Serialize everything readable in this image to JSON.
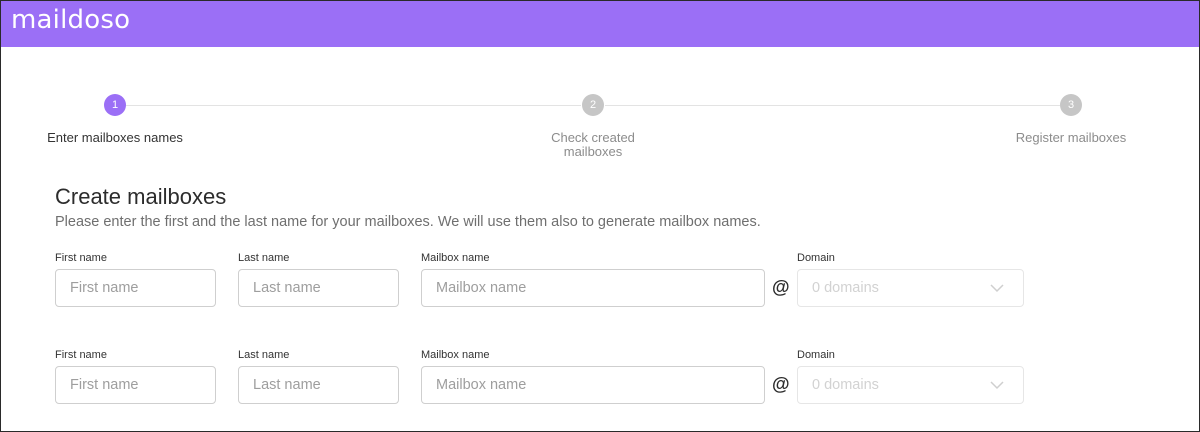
{
  "app": {
    "logo_text": "maildoso",
    "brand_color": "#9b6ff6"
  },
  "stepper": {
    "steps": [
      {
        "number": "1",
        "label": "Enter mailboxes names",
        "state": "active"
      },
      {
        "number": "2",
        "label": "Check created mailboxes",
        "state": "inactive"
      },
      {
        "number": "3",
        "label": "Register mailboxes",
        "state": "inactive"
      }
    ]
  },
  "form": {
    "title": "Create mailboxes",
    "subtitle": "Please enter the first and the last name for your mailboxes. We will use them also to generate mailbox names.",
    "rows": [
      {
        "first_name_label": "First name",
        "first_name_placeholder": "First name",
        "first_name_value": "",
        "last_name_label": "Last name",
        "last_name_placeholder": "Last name",
        "last_name_value": "",
        "mailbox_label": "Mailbox name",
        "mailbox_placeholder": "Mailbox name",
        "mailbox_value": "",
        "at_sign": "@",
        "domain_label": "Domain",
        "domain_value": "0 domains"
      },
      {
        "first_name_label": "First name",
        "first_name_placeholder": "First name",
        "first_name_value": "",
        "last_name_label": "Last name",
        "last_name_placeholder": "Last name",
        "last_name_value": "",
        "mailbox_label": "Mailbox name",
        "mailbox_placeholder": "Mailbox name",
        "mailbox_value": "",
        "at_sign": "@",
        "domain_label": "Domain",
        "domain_value": "0 domains"
      }
    ]
  }
}
